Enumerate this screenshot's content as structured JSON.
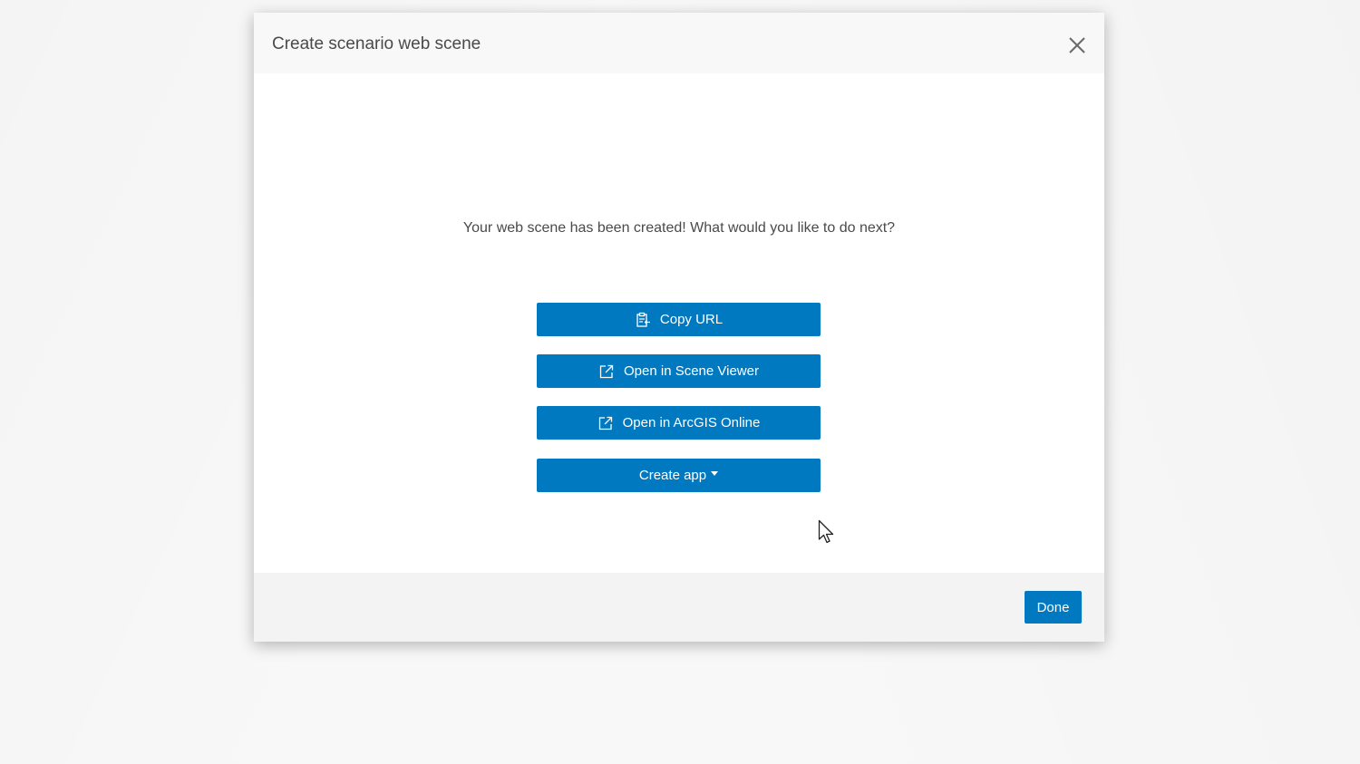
{
  "dialog": {
    "title": "Create scenario web scene",
    "close_icon": "close-icon",
    "message": "Your web scene has been created! What would you like to do next?"
  },
  "actions": [
    {
      "label": "Copy URL",
      "icon": "clipboard-copy-icon"
    },
    {
      "label": "Open in Scene Viewer",
      "icon": "external-link-icon"
    },
    {
      "label": "Open in ArcGIS Online",
      "icon": "external-link-icon"
    },
    {
      "label": "Create app",
      "icon": "caret-down-icon"
    }
  ],
  "footer": {
    "done_label": "Done"
  },
  "colors": {
    "primary": "#0079c1",
    "header_bg": "#f8f8f8",
    "footer_bg": "#f3f3f3",
    "text": "#4a4a4a"
  }
}
